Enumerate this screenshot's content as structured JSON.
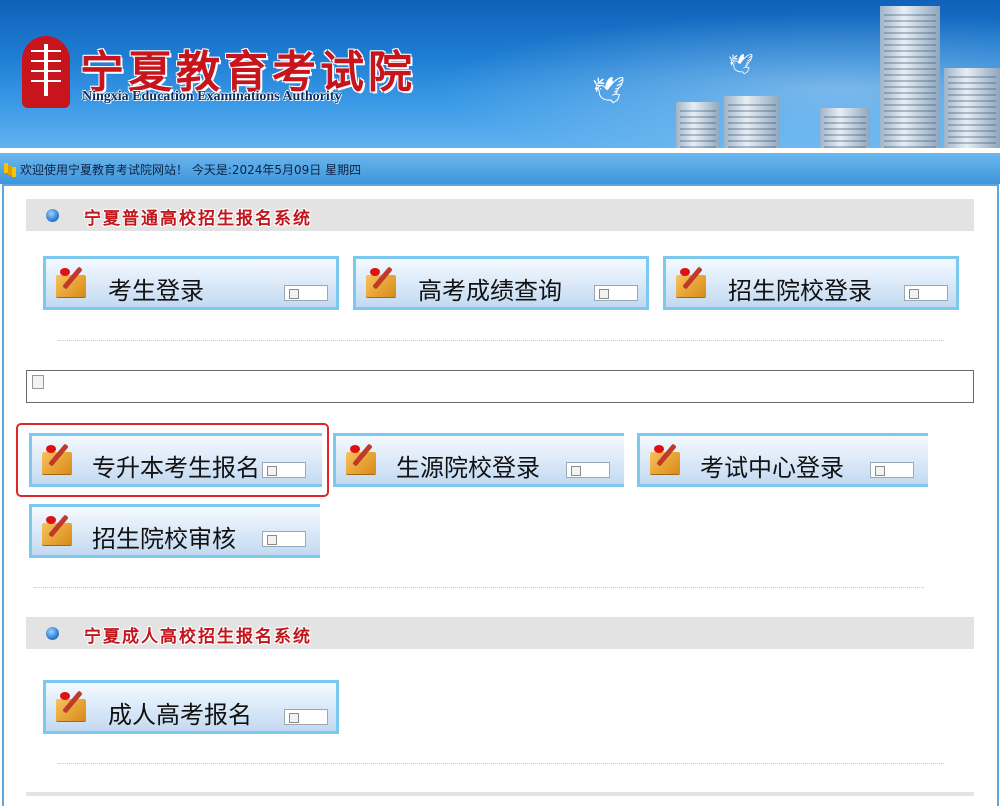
{
  "header": {
    "title_cn": "宁夏教育考试院",
    "title_en": "Ningxia Education Examinations Authority"
  },
  "welcome_bar": {
    "text": "欢迎使用宁夏教育考试院网站！ 今天是:2024年5月09日 星期四"
  },
  "sections": [
    {
      "title": "宁夏普通高校招生报名系统",
      "buttons_row1": [
        "考生登录",
        "高考成绩查询",
        "招生院校登录"
      ],
      "buttons_row2": [
        "专升本考生报名",
        "生源院校登录",
        "考试中心登录"
      ],
      "buttons_row3": [
        "招生院校审核"
      ]
    },
    {
      "title": "宁夏成人高校招生报名系统",
      "buttons": [
        "成人高考报名"
      ]
    }
  ],
  "colors": {
    "accent_red": "#c0171d",
    "frame_blue": "#5aa8df",
    "highlight": "#e0262b"
  }
}
